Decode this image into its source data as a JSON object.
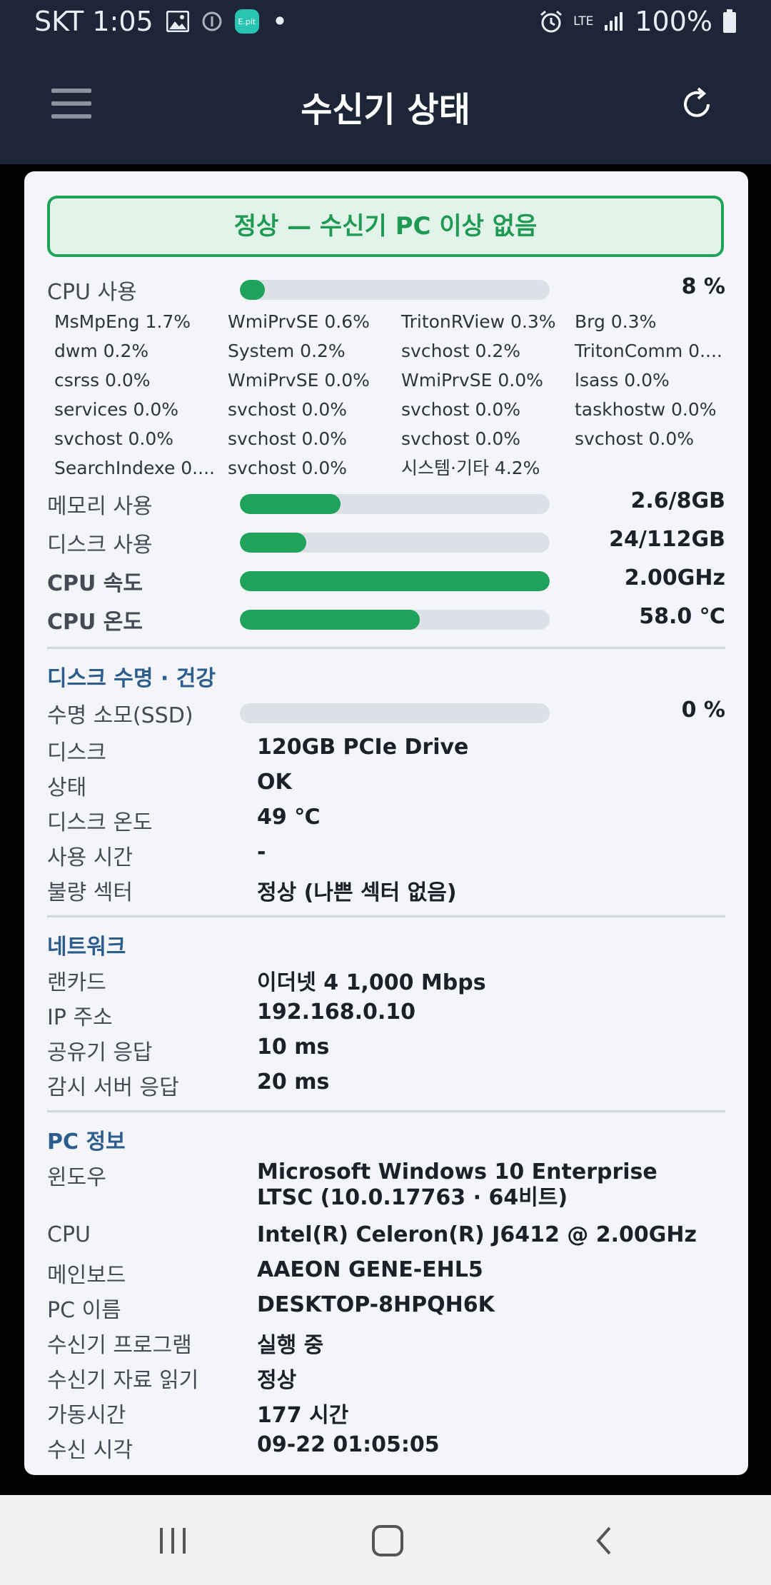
{
  "status_bar": {
    "carrier_time": "SKT 1:05",
    "epit_label": "E.pit",
    "dot": "•",
    "network": "LTE",
    "battery": "100%"
  },
  "app_bar": {
    "title": "수신기 상태"
  },
  "banner": {
    "text": "정상 — 수신기 PC 이상 없음",
    "color": "#1fa35a"
  },
  "cpu_usage": {
    "label": "CPU 사용",
    "value": "8 %",
    "fraction": 0.08
  },
  "processes": [
    [
      "MsMpEng 1.7%",
      "WmiPrvSE 0.6%",
      "TritonRView 0.3%",
      "Brg 0.3%"
    ],
    [
      "dwm 0.2%",
      "System 0.2%",
      "svchost 0.2%",
      "TritonComm 0...."
    ],
    [
      "csrss 0.0%",
      "WmiPrvSE 0.0%",
      "WmiPrvSE 0.0%",
      "lsass 0.0%"
    ],
    [
      "services 0.0%",
      "svchost 0.0%",
      "svchost 0.0%",
      "taskhostw 0.0%"
    ],
    [
      "svchost 0.0%",
      "svchost 0.0%",
      "svchost 0.0%",
      "svchost 0.0%"
    ],
    [
      "SearchIndexe 0....",
      "svchost 0.0%",
      "시스템·기타 4.2%",
      ""
    ]
  ],
  "metrics": [
    {
      "label": "메모리 사용",
      "value": "2.6/8GB",
      "fraction": 0.325,
      "bold": false
    },
    {
      "label": "디스크 사용",
      "value": "24/112GB",
      "fraction": 0.214,
      "bold": false
    },
    {
      "label": "CPU 속도",
      "value": "2.00GHz",
      "fraction": 1.0,
      "bold": true
    },
    {
      "label": "CPU 온도",
      "value": "58.0 ℃",
      "fraction": 0.58,
      "bold": true
    }
  ],
  "disk_section": {
    "title": "디스크 수명 · 건강",
    "wear_label": "수명 소모(SSD)",
    "wear_value": "0 %",
    "wear_fraction": 0,
    "rows": [
      {
        "key": "디스크",
        "value": "120GB PCIe Drive"
      },
      {
        "key": "상태",
        "value": "OK"
      },
      {
        "key": "디스크 온도",
        "value": "49 ℃"
      },
      {
        "key": "사용 시간",
        "value": "-"
      },
      {
        "key": "불량 섹터",
        "value": "정상 (나쁜 섹터 없음)"
      }
    ]
  },
  "network_section": {
    "title": "네트워크",
    "rows": [
      {
        "key": "랜카드",
        "value": "이더넷 4   1,000 Mbps"
      },
      {
        "key": "IP 주소",
        "value": "192.168.0.10"
      },
      {
        "key": "공유기 응답",
        "value": "10 ms"
      },
      {
        "key": "감시 서버 응답",
        "value": "20 ms"
      }
    ]
  },
  "pc_section": {
    "title": "PC 정보",
    "windows_key": "윈도우",
    "windows_value": "Microsoft Windows 10 Enterprise LTSC (10.0.17763 · 64비트)",
    "rows": [
      {
        "key": "CPU",
        "value": "Intel(R) Celeron(R) J6412 @ 2.00GHz"
      },
      {
        "key": "메인보드",
        "value": "AAEON GENE-EHL5"
      },
      {
        "key": "PC 이름",
        "value": "DESKTOP-8HPQH6K"
      },
      {
        "key": "수신기 프로그램",
        "value": "실행 중"
      },
      {
        "key": "수신기 자료 읽기",
        "value": "정상"
      },
      {
        "key": "가동시간",
        "value": "177 시간"
      },
      {
        "key": "수신 시각",
        "value": "09-22 01:05:05"
      }
    ]
  },
  "icons": {
    "menu": "hamburger-icon",
    "refresh": "refresh-icon",
    "recents": "recents-icon",
    "home": "home-icon",
    "back": "back-icon"
  }
}
